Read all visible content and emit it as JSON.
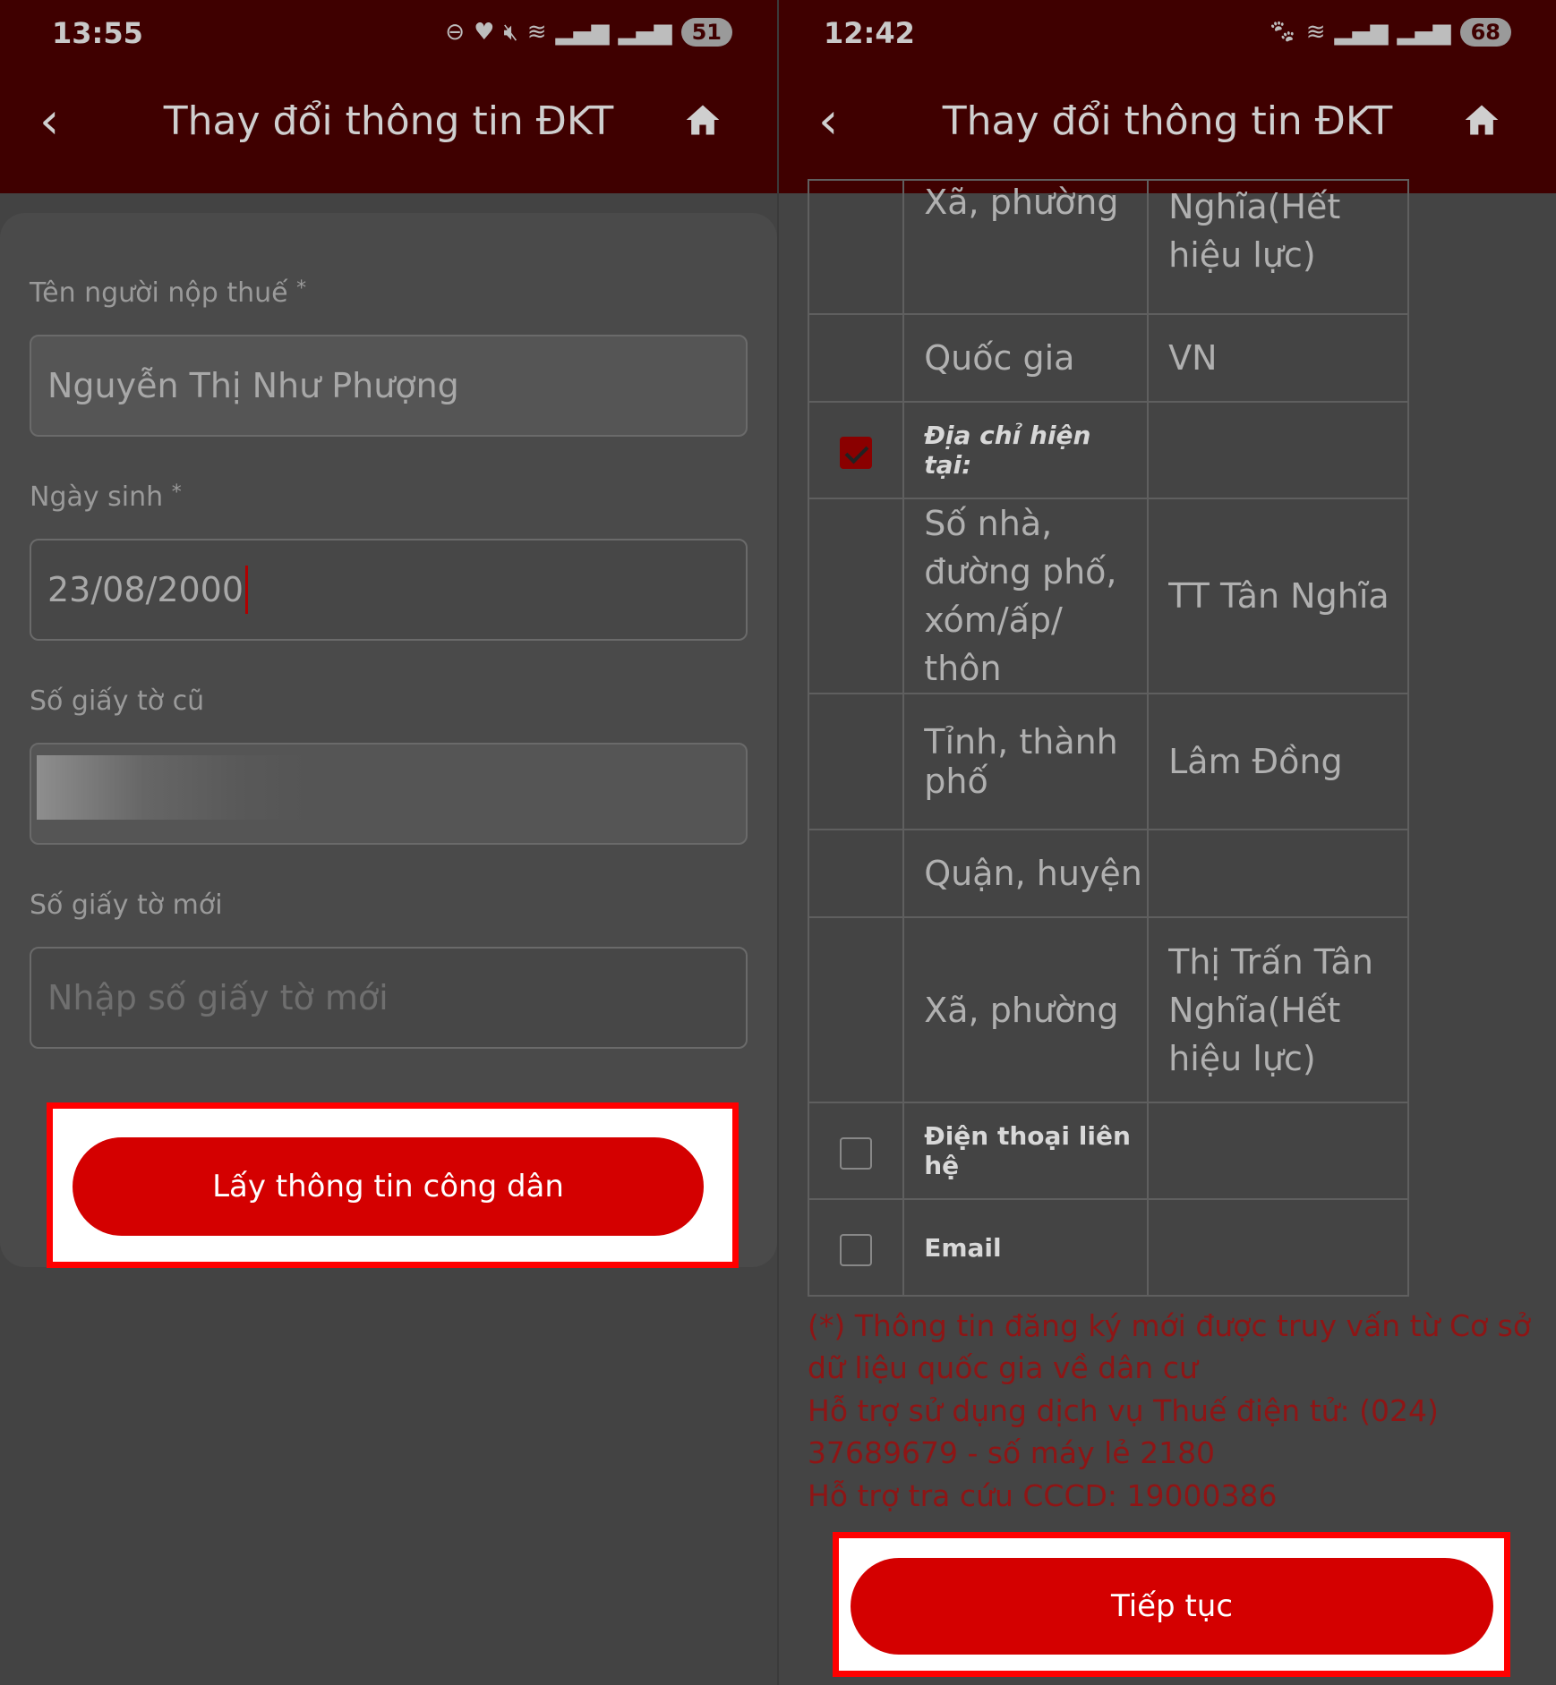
{
  "left": {
    "status": {
      "time": "13:55",
      "battery": "51"
    },
    "header": {
      "title": "Thay đổi thông tin ĐKT"
    },
    "form": {
      "taxpayer_label": "Tên người nộp thuế",
      "taxpayer_value": "Nguyễn Thị Như Phượng",
      "dob_label": "Ngày sinh",
      "dob_value": "23/08/2000",
      "old_doc_label": "Số giấy tờ cũ",
      "new_doc_label": "Số giấy tờ mới",
      "new_doc_placeholder": "Nhập số giấy tờ mới",
      "required_mark": "*"
    },
    "button_label": "Lấy thông tin công dân"
  },
  "right": {
    "status": {
      "time": "12:42",
      "battery": "68"
    },
    "header": {
      "title": "Thay đổi thông tin ĐKT"
    },
    "rows": [
      {
        "field": "Xã, phường",
        "value": "Nghĩa(Hết hiệu lực)",
        "checkbox": "none"
      },
      {
        "field": "Quốc gia",
        "value": "VN",
        "checkbox": "none"
      },
      {
        "field": "Địa chỉ hiện tại:",
        "value": "",
        "checkbox": "checked"
      },
      {
        "field": "Số nhà, đường phố, xóm/ấp/ thôn",
        "value": "TT Tân Nghĩa",
        "checkbox": "none"
      },
      {
        "field": "Tỉnh, thành phố",
        "value": "Lâm Đồng",
        "checkbox": "none"
      },
      {
        "field": "Quận, huyện",
        "value": "",
        "checkbox": "none"
      },
      {
        "field": "Xã, phường",
        "value": "Thị Trấn Tân Nghĩa(Hết hiệu lực)",
        "checkbox": "none"
      },
      {
        "field": "Điện thoại liên hệ",
        "value": "",
        "checkbox": "unchecked"
      },
      {
        "field": "Email",
        "value": "",
        "checkbox": "unchecked"
      }
    ],
    "notes": {
      "line1": "(*) Thông tin đăng ký mới được truy vấn từ Cơ sở dữ liệu quốc gia về dân cư",
      "line2": "Hỗ trợ sử dụng dịch vụ Thuế điện tử: (024) 37689679 - số máy lẻ 2180",
      "line3": "Hỗ trợ tra cứu CCCD: 19000386"
    },
    "button_label": "Tiếp tục"
  },
  "colors": {
    "accent": "#d40000",
    "header_bg": "#3f0000",
    "highlight_border": "#ff0000"
  }
}
